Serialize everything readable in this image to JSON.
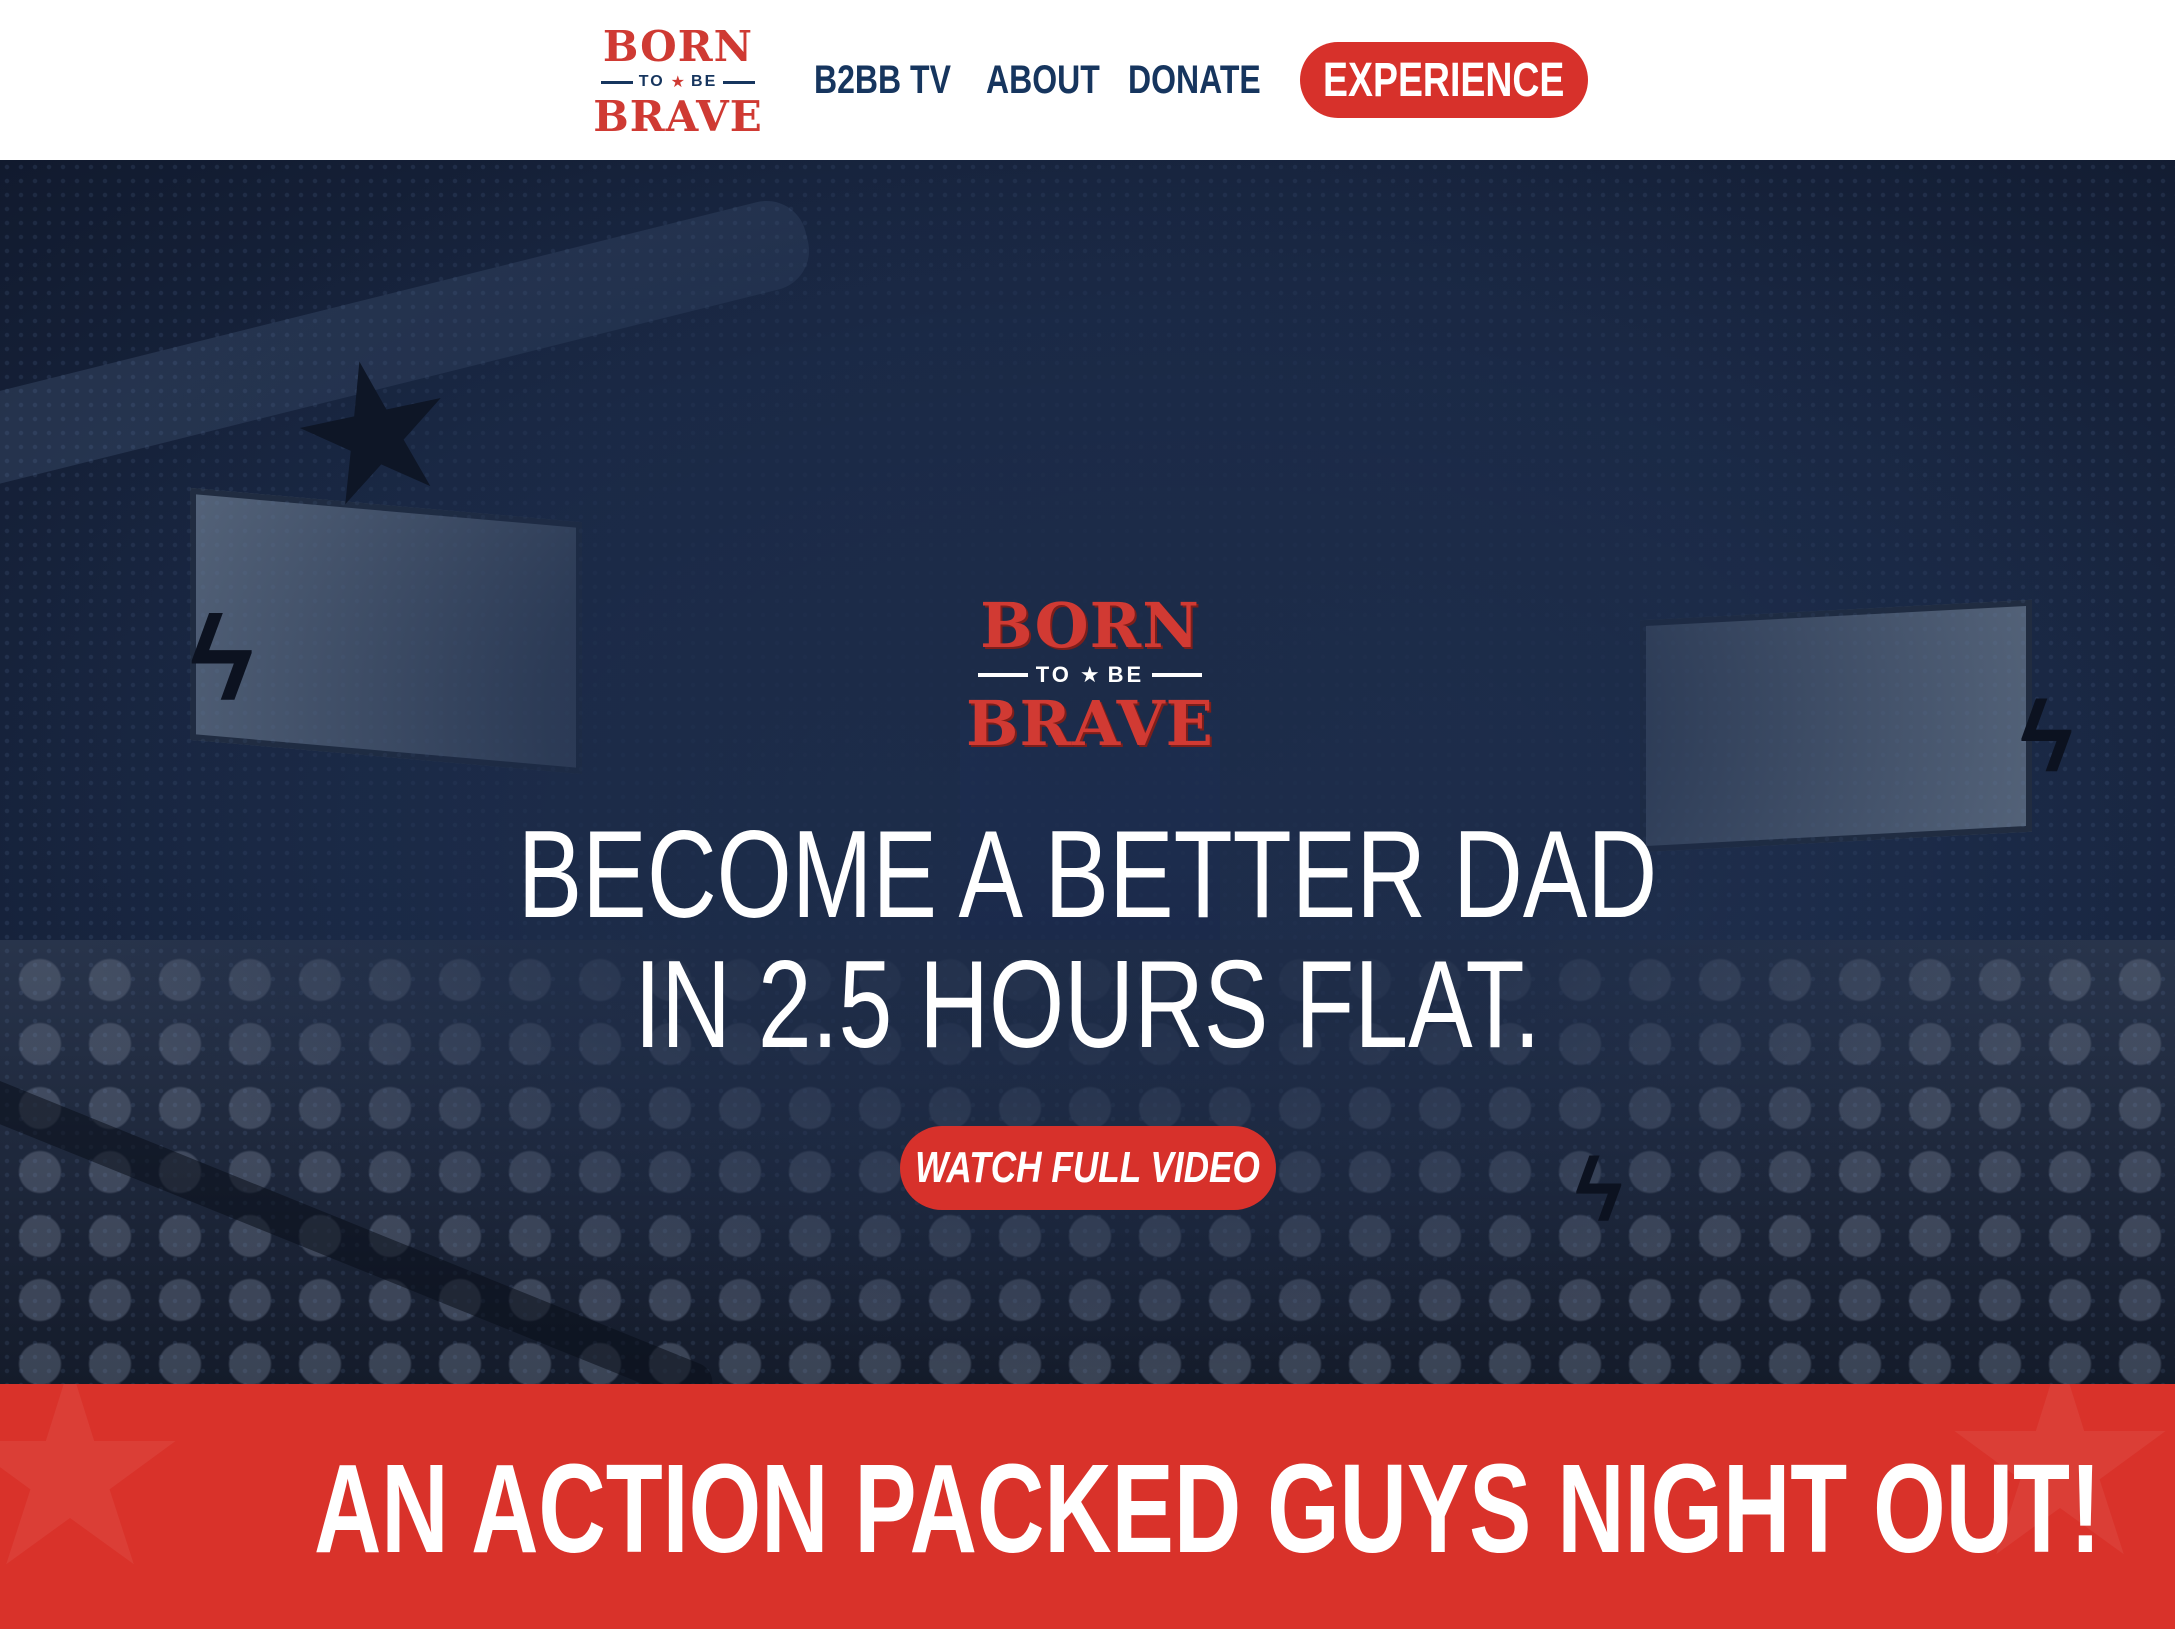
{
  "header": {
    "logo": {
      "top": "BORN",
      "middle": "TO",
      "middle2": "BE",
      "bottom": "BRAVE"
    },
    "nav": [
      {
        "label": "B2BB TV"
      },
      {
        "label": "ABOUT"
      },
      {
        "label": "DONATE"
      }
    ],
    "cta_label": "EXPERIENCE"
  },
  "hero": {
    "logo": {
      "top": "BORN",
      "middle": "TO",
      "middle2": "BE",
      "bottom": "BRAVE"
    },
    "headline_line1": "BECOME A BETTER DAD",
    "headline_line2": "IN 2.5 HOURS FLAT.",
    "button_label": "WATCH FULL VIDEO"
  },
  "banner": {
    "text": "AN ACTION PACKED GUYS NIGHT OUT!"
  },
  "colors": {
    "brand_red": "#d7312b",
    "navy": "#16355e",
    "hero_bg": "#1b2a47"
  }
}
